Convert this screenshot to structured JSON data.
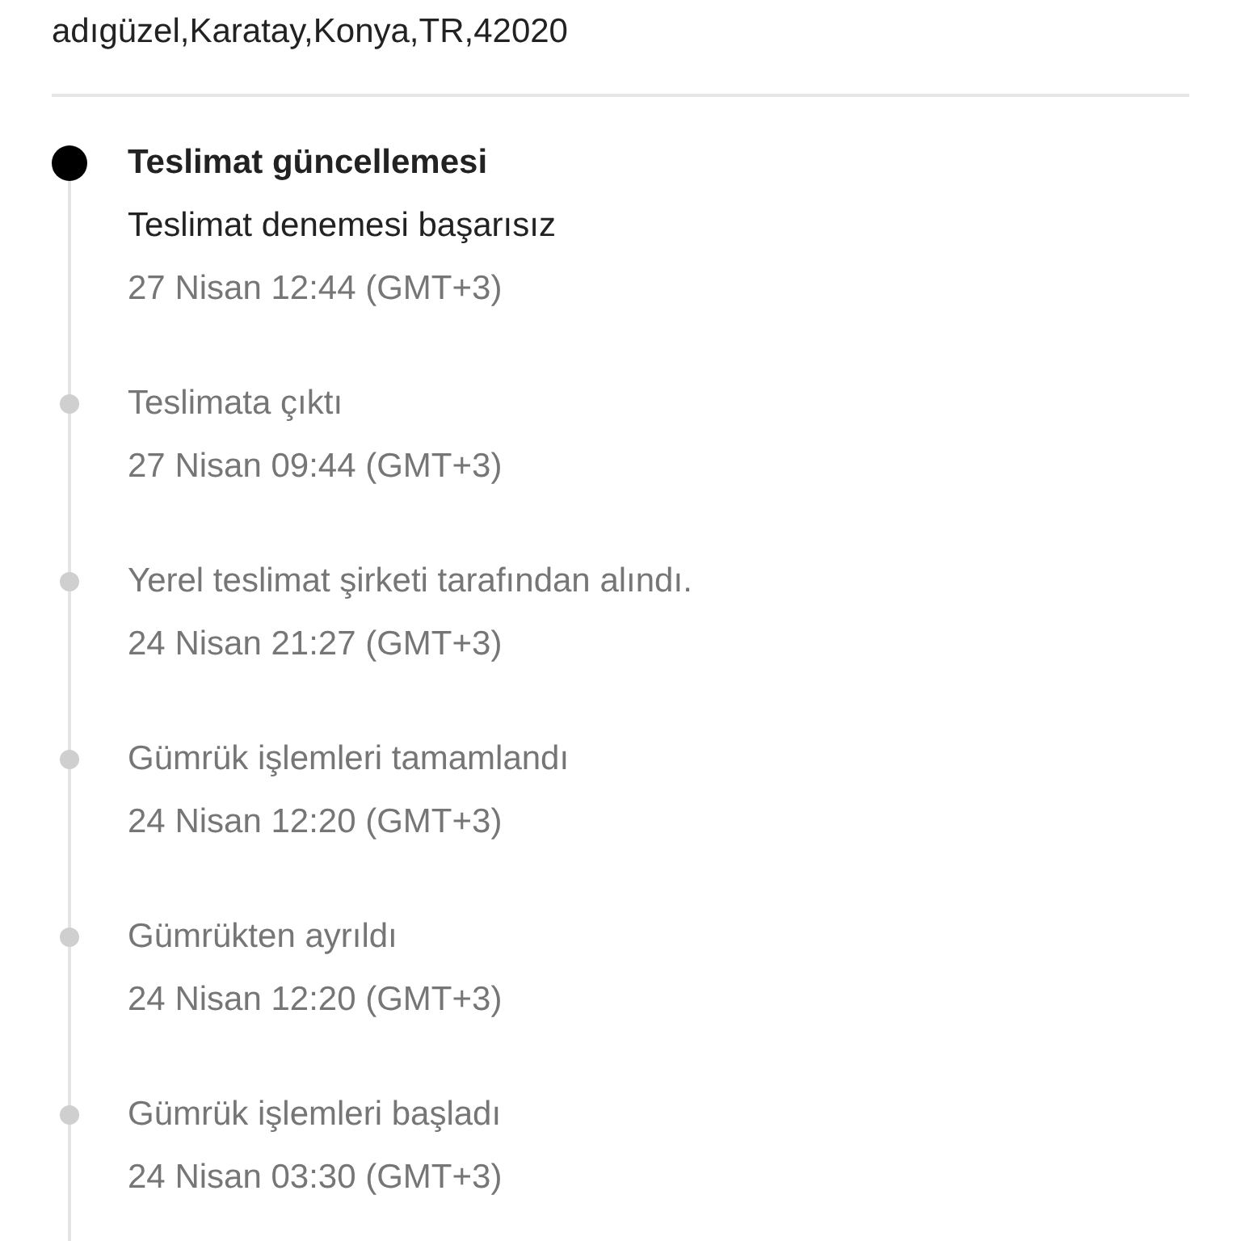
{
  "address": "adıgüzel,Karatay,Konya,TR,42020",
  "events": [
    {
      "title": "Teslimat güncellemesi",
      "detail": "Teslimat denemesi başarısız",
      "time": "27 Nisan 12:44 (GMT+3)",
      "current": true
    },
    {
      "title": "Teslimata çıktı",
      "time": "27 Nisan 09:44 (GMT+3)",
      "current": false
    },
    {
      "title": "Yerel teslimat şirketi tarafından alındı.",
      "time": "24 Nisan 21:27 (GMT+3)",
      "current": false
    },
    {
      "title": "Gümrük işlemleri tamamlandı",
      "time": "24 Nisan 12:20 (GMT+3)",
      "current": false
    },
    {
      "title": "Gümrükten ayrıldı",
      "time": "24 Nisan 12:20 (GMT+3)",
      "current": false
    },
    {
      "title": "Gümrük işlemleri başladı",
      "time": "24 Nisan 03:30 (GMT+3)",
      "current": false
    }
  ]
}
